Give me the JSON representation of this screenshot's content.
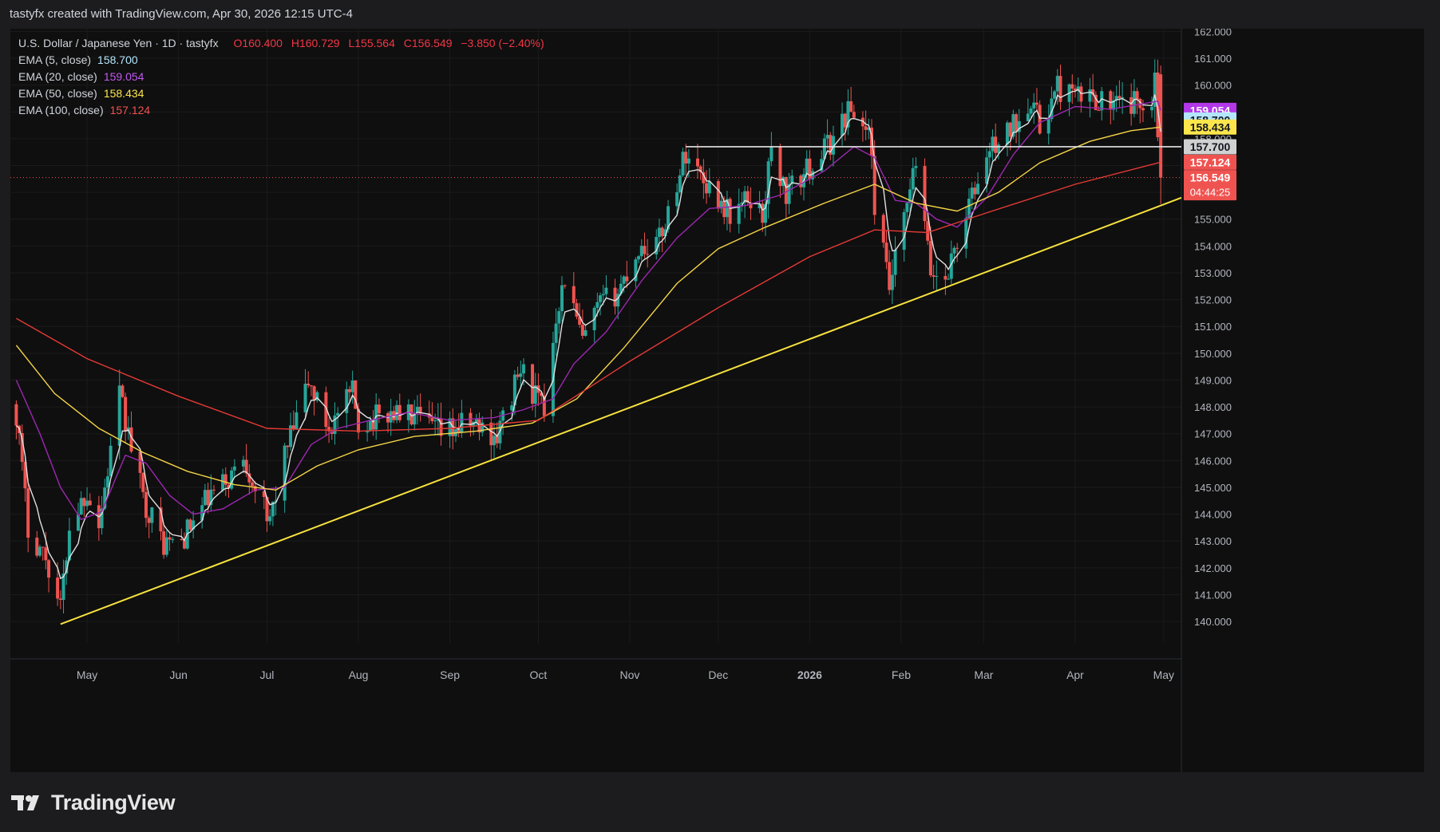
{
  "header": {
    "attribution": "tastyfx created with TradingView.com, Apr 30, 2026 12:15 UTC-4"
  },
  "legend": {
    "symbol": "U.S. Dollar / Japanese Yen · 1D · tastyfx",
    "ohlc": {
      "o": "O160.400",
      "h": "H160.729",
      "l": "L155.564",
      "c": "C156.549",
      "chg": "−3.850 (−2.40%)"
    },
    "ema5": {
      "label": "EMA (5, close)",
      "value": "158.700"
    },
    "ema20": {
      "label": "EMA (20, close)",
      "value": "159.054"
    },
    "ema50": {
      "label": "EMA (50, close)",
      "value": "158.434"
    },
    "ema100": {
      "label": "EMA (100, close)",
      "value": "157.124"
    }
  },
  "footer": {
    "brand": "TradingView"
  },
  "colors": {
    "up": "#26a69a",
    "down": "#ef5350",
    "background": "#0f0f0f",
    "ema5": "#e0e0e0",
    "ema20": "#9c27b0",
    "ema50": "#f5d547",
    "ema100": "#e53935",
    "trendline": "#f7e23e",
    "resistance": "#e6e6e6"
  },
  "chart_data": {
    "type": "candlestick",
    "title": "U.S. Dollar / Japanese Yen · 1D · tastyfx",
    "ylim": [
      139.2,
      162.1
    ],
    "yticks": [
      "140.000",
      "141.000",
      "142.000",
      "143.000",
      "144.000",
      "145.000",
      "146.000",
      "147.000",
      "148.000",
      "149.000",
      "150.000",
      "151.000",
      "152.000",
      "153.000",
      "154.000",
      "155.000",
      "156.000",
      "157.000",
      "158.000",
      "159.000",
      "160.000",
      "161.000",
      "162.000"
    ],
    "x_range": [
      "2025-04-05",
      "2026-05-07"
    ],
    "xticks": [
      {
        "date": "2025-05-01",
        "label": "May"
      },
      {
        "date": "2025-06-01",
        "label": "Jun"
      },
      {
        "date": "2025-07-01",
        "label": "Jul"
      },
      {
        "date": "2025-08-01",
        "label": "Aug"
      },
      {
        "date": "2025-09-01",
        "label": "Sep"
      },
      {
        "date": "2025-10-01",
        "label": "Oct"
      },
      {
        "date": "2025-11-01",
        "label": "Nov"
      },
      {
        "date": "2025-12-01",
        "label": "Dec"
      },
      {
        "date": "2026-01-01",
        "label": "2026"
      },
      {
        "date": "2026-02-01",
        "label": "Feb"
      },
      {
        "date": "2026-03-01",
        "label": "Mar"
      },
      {
        "date": "2026-04-01",
        "label": "Apr"
      },
      {
        "date": "2026-05-01",
        "label": "May"
      }
    ],
    "close_path": [
      [
        "2025-04-07",
        147.8
      ],
      [
        "2025-04-11",
        143.5
      ],
      [
        "2025-04-17",
        142.4
      ],
      [
        "2025-04-22",
        140.5
      ],
      [
        "2025-04-25",
        143.6
      ],
      [
        "2025-05-01",
        144.9
      ],
      [
        "2025-05-05",
        143.6
      ],
      [
        "2025-05-12",
        148.4
      ],
      [
        "2025-05-20",
        144.6
      ],
      [
        "2025-05-27",
        142.9
      ],
      [
        "2025-06-02",
        143.0
      ],
      [
        "2025-06-11",
        144.6
      ],
      [
        "2025-06-18",
        145.3
      ],
      [
        "2025-06-23",
        146.2
      ],
      [
        "2025-06-30",
        144.2
      ],
      [
        "2025-07-01",
        143.4
      ],
      [
        "2025-07-07",
        146.2
      ],
      [
        "2025-07-15",
        148.9
      ],
      [
        "2025-07-22",
        147.2
      ],
      [
        "2025-07-30",
        148.5
      ],
      [
        "2025-08-01",
        147.4
      ],
      [
        "2025-08-13",
        147.8
      ],
      [
        "2025-08-20",
        147.6
      ],
      [
        "2025-08-29",
        147.0
      ],
      [
        "2025-09-08",
        147.4
      ],
      [
        "2025-09-17",
        146.9
      ],
      [
        "2025-09-25",
        149.4
      ],
      [
        "2025-10-03",
        147.8
      ],
      [
        "2025-10-07",
        151.5
      ],
      [
        "2025-10-10",
        152.8
      ],
      [
        "2025-10-16",
        150.4
      ],
      [
        "2025-10-22",
        151.8
      ],
      [
        "2025-10-28",
        152.3
      ],
      [
        "2025-11-04",
        153.9
      ],
      [
        "2025-11-11",
        154.2
      ],
      [
        "2025-11-20",
        157.5
      ],
      [
        "2025-11-28",
        156.2
      ],
      [
        "2025-12-05",
        155.2
      ],
      [
        "2025-12-12",
        155.8
      ],
      [
        "2025-12-16",
        155.1
      ],
      [
        "2025-12-19",
        157.6
      ],
      [
        "2025-12-24",
        155.9
      ],
      [
        "2025-12-31",
        156.8
      ],
      [
        "2026-01-09",
        158.0
      ],
      [
        "2026-01-14",
        159.1
      ],
      [
        "2026-01-21",
        158.3
      ],
      [
        "2026-01-23",
        155.6
      ],
      [
        "2026-01-28",
        152.4
      ],
      [
        "2026-02-03",
        155.4
      ],
      [
        "2026-02-06",
        157.1
      ],
      [
        "2026-02-11",
        153.0
      ],
      [
        "2026-02-16",
        152.8
      ],
      [
        "2026-02-23",
        155.2
      ],
      [
        "2026-02-26",
        156.1
      ],
      [
        "2026-03-03",
        157.6
      ],
      [
        "2026-03-10",
        158.3
      ],
      [
        "2026-03-17",
        159.6
      ],
      [
        "2026-03-20",
        158.4
      ],
      [
        "2026-03-26",
        159.9
      ],
      [
        "2026-04-02",
        159.5
      ],
      [
        "2026-04-07",
        159.6
      ],
      [
        "2026-04-14",
        159.2
      ],
      [
        "2026-04-21",
        159.3
      ],
      [
        "2026-04-27",
        159.6
      ],
      [
        "2026-04-28",
        160.4
      ],
      [
        "2026-04-30",
        156.549
      ]
    ],
    "last_candle": {
      "date": "2026-04-30",
      "open": 160.4,
      "high": 160.729,
      "low": 155.564,
      "close": 156.549
    },
    "series": [
      {
        "name": "EMA (5, close)",
        "key": "ema5",
        "points": []
      },
      {
        "name": "EMA (20, close)",
        "key": "ema20",
        "points": [
          [
            "2025-04-07",
            149.0
          ],
          [
            "2025-04-15",
            147.0
          ],
          [
            "2025-04-22",
            145.0
          ],
          [
            "2025-04-29",
            143.8
          ],
          [
            "2025-05-06",
            144.1
          ],
          [
            "2025-05-14",
            146.2
          ],
          [
            "2025-05-21",
            145.9
          ],
          [
            "2025-05-29",
            144.7
          ],
          [
            "2025-06-06",
            144.0
          ],
          [
            "2025-06-16",
            144.2
          ],
          [
            "2025-06-27",
            144.9
          ],
          [
            "2025-07-07",
            145.0
          ],
          [
            "2025-07-16",
            146.6
          ],
          [
            "2025-07-25",
            147.2
          ],
          [
            "2025-08-05",
            147.5
          ],
          [
            "2025-08-18",
            147.8
          ],
          [
            "2025-09-01",
            147.5
          ],
          [
            "2025-09-16",
            147.6
          ],
          [
            "2025-09-26",
            147.9
          ],
          [
            "2025-10-06",
            148.3
          ],
          [
            "2025-10-13",
            149.6
          ],
          [
            "2025-10-24",
            150.8
          ],
          [
            "2025-11-05",
            152.7
          ],
          [
            "2025-11-17",
            154.3
          ],
          [
            "2025-11-28",
            155.4
          ],
          [
            "2025-12-10",
            155.5
          ],
          [
            "2025-12-22",
            155.9
          ],
          [
            "2026-01-06",
            156.8
          ],
          [
            "2026-01-16",
            157.7
          ],
          [
            "2026-01-23",
            157.3
          ],
          [
            "2026-01-30",
            155.7
          ],
          [
            "2026-02-06",
            155.6
          ],
          [
            "2026-02-13",
            155.0
          ],
          [
            "2026-02-20",
            154.7
          ],
          [
            "2026-03-02",
            155.8
          ],
          [
            "2026-03-11",
            157.4
          ],
          [
            "2026-03-20",
            158.6
          ],
          [
            "2026-04-01",
            159.2
          ],
          [
            "2026-04-13",
            159.1
          ],
          [
            "2026-04-24",
            159.3
          ],
          [
            "2026-04-29",
            159.4
          ],
          [
            "2026-04-30",
            159.054
          ]
        ]
      },
      {
        "name": "EMA (50, close)",
        "key": "ema50",
        "points": [
          [
            "2025-04-07",
            150.3
          ],
          [
            "2025-04-20",
            148.5
          ],
          [
            "2025-05-05",
            147.2
          ],
          [
            "2025-05-20",
            146.3
          ],
          [
            "2025-06-04",
            145.6
          ],
          [
            "2025-06-20",
            145.1
          ],
          [
            "2025-07-04",
            144.9
          ],
          [
            "2025-07-18",
            145.8
          ],
          [
            "2025-08-01",
            146.4
          ],
          [
            "2025-08-20",
            146.9
          ],
          [
            "2025-09-10",
            147.1
          ],
          [
            "2025-09-29",
            147.4
          ],
          [
            "2025-10-14",
            148.3
          ],
          [
            "2025-10-30",
            150.2
          ],
          [
            "2025-11-17",
            152.6
          ],
          [
            "2025-12-01",
            153.9
          ],
          [
            "2025-12-17",
            154.7
          ],
          [
            "2026-01-06",
            155.6
          ],
          [
            "2026-01-23",
            156.3
          ],
          [
            "2026-02-06",
            155.6
          ],
          [
            "2026-02-20",
            155.3
          ],
          [
            "2026-03-06",
            156.0
          ],
          [
            "2026-03-20",
            157.1
          ],
          [
            "2026-04-06",
            157.9
          ],
          [
            "2026-04-20",
            158.3
          ],
          [
            "2026-04-30",
            158.434
          ]
        ]
      },
      {
        "name": "EMA (100, close)",
        "key": "ema100",
        "points": [
          [
            "2025-04-07",
            151.3
          ],
          [
            "2025-05-01",
            149.8
          ],
          [
            "2025-06-01",
            148.4
          ],
          [
            "2025-07-01",
            147.2
          ],
          [
            "2025-08-01",
            147.1
          ],
          [
            "2025-09-01",
            147.2
          ],
          [
            "2025-10-01",
            147.5
          ],
          [
            "2025-11-01",
            149.7
          ],
          [
            "2025-12-01",
            151.7
          ],
          [
            "2026-01-01",
            153.6
          ],
          [
            "2026-01-23",
            154.6
          ],
          [
            "2026-02-10",
            154.5
          ],
          [
            "2026-03-01",
            155.2
          ],
          [
            "2026-04-01",
            156.3
          ],
          [
            "2026-04-30",
            157.124
          ]
        ]
      }
    ],
    "trendline": {
      "from": [
        "2025-04-22",
        139.9
      ],
      "to": [
        "2026-05-07",
        155.8
      ]
    },
    "resistance": {
      "from": [
        "2025-11-20",
        157.7
      ],
      "to": [
        "2026-05-07",
        157.7
      ]
    },
    "price_labels": [
      {
        "value": 159.054,
        "text": "159.054",
        "color": "#b338e8",
        "text_color": "#ffffff"
      },
      {
        "value": 158.7,
        "text": "158.700",
        "color": "#b3e5fc",
        "text_color": "#131722"
      },
      {
        "value": 158.434,
        "text": "158.434",
        "color": "#fde64b",
        "text_color": "#131722"
      },
      {
        "value": 157.7,
        "text": "157.700",
        "color": "#d1d1d1",
        "text_color": "#131722"
      },
      {
        "value": 157.124,
        "text": "157.124",
        "color": "#ef5350",
        "text_color": "#ffffff"
      },
      {
        "value": 156.549,
        "text": "156.549",
        "color": "#ef5350",
        "text_color": "#ffffff",
        "countdown": "04:44:25"
      }
    ]
  }
}
